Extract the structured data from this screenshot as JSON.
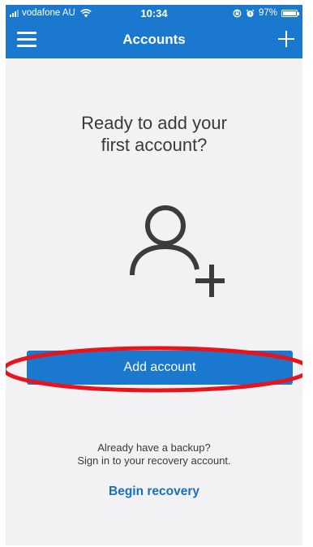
{
  "status_bar": {
    "carrier": "vodafone AU",
    "time": "10:34",
    "battery_percent": "97%",
    "battery_level": 0.97
  },
  "nav": {
    "title": "Accounts",
    "menu_icon": "hamburger-menu-icon",
    "add_icon": "plus-icon"
  },
  "main": {
    "headline": "Ready to add your\nfirst account?",
    "illustration_icon": "add-person-icon",
    "add_account_label": "Add account",
    "backup_line1": "Already have a backup?",
    "backup_line2": "Sign in to your recovery account.",
    "recovery_label": "Begin recovery"
  },
  "colors": {
    "brand_blue": "#1a78cf",
    "background": "#f2f2f4",
    "highlight_red": "#e8131b"
  }
}
